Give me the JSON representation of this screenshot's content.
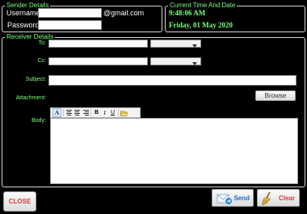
{
  "sender": {
    "legend": "Sender Details",
    "username_label": "Username",
    "password_label": "Password",
    "username_value": "",
    "password_value": "",
    "domain": "@gmail.com"
  },
  "time_panel": {
    "legend": "Current Time And Date",
    "time": "9:48:06 AM",
    "date": "Friday, 01 May  2020"
  },
  "receiver": {
    "legend": "Receiver Details",
    "to_label": "To:",
    "cc_label": "Cc:",
    "subject_label": "Subject:",
    "attachment_label": "Attachment:",
    "body_label": "Body:",
    "to_value": "",
    "cc_value": "",
    "subject_value": "",
    "body_value": "",
    "to_select_value": "",
    "cc_select_value": "",
    "browse_label": "Browse"
  },
  "editor_toolbar": {
    "font_color": "A",
    "bold": "B",
    "italic": "I",
    "underline": "U"
  },
  "footer": {
    "close_label": "CLOSE",
    "send_label": "Send",
    "clear_label": "Clear"
  },
  "colors": {
    "label_green": "#7cff7c",
    "close_text": "#d93a3a",
    "send_text": "#1e6fd9",
    "clear_text": "#d93a3a"
  }
}
